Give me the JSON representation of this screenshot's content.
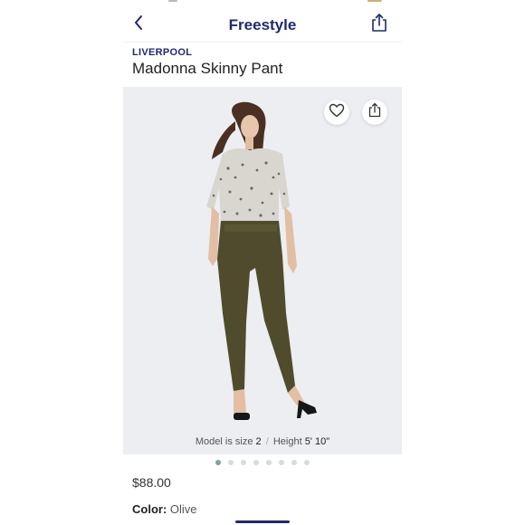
{
  "nav": {
    "title": "Freestyle",
    "back_icon": "chevron-left-icon",
    "share_icon": "share-icon"
  },
  "product": {
    "brand": "LIVERPOOL",
    "name": "Madonna Skinny Pant",
    "price": "$88.00",
    "color_label": "Color:",
    "color_value": "Olive"
  },
  "image": {
    "caption_prefix": "Model is size",
    "caption_size": "2",
    "caption_sep": "/",
    "caption_height_label": "Height",
    "caption_height": "5' 10\"",
    "favorite_icon": "heart-icon",
    "share_icon": "share-icon",
    "carousel_total": 8,
    "carousel_active_index": 0
  },
  "colors": {
    "brand_navy": "#1f2a6b",
    "dot_active": "#7aa7a0",
    "image_bg": "#eceef1"
  }
}
